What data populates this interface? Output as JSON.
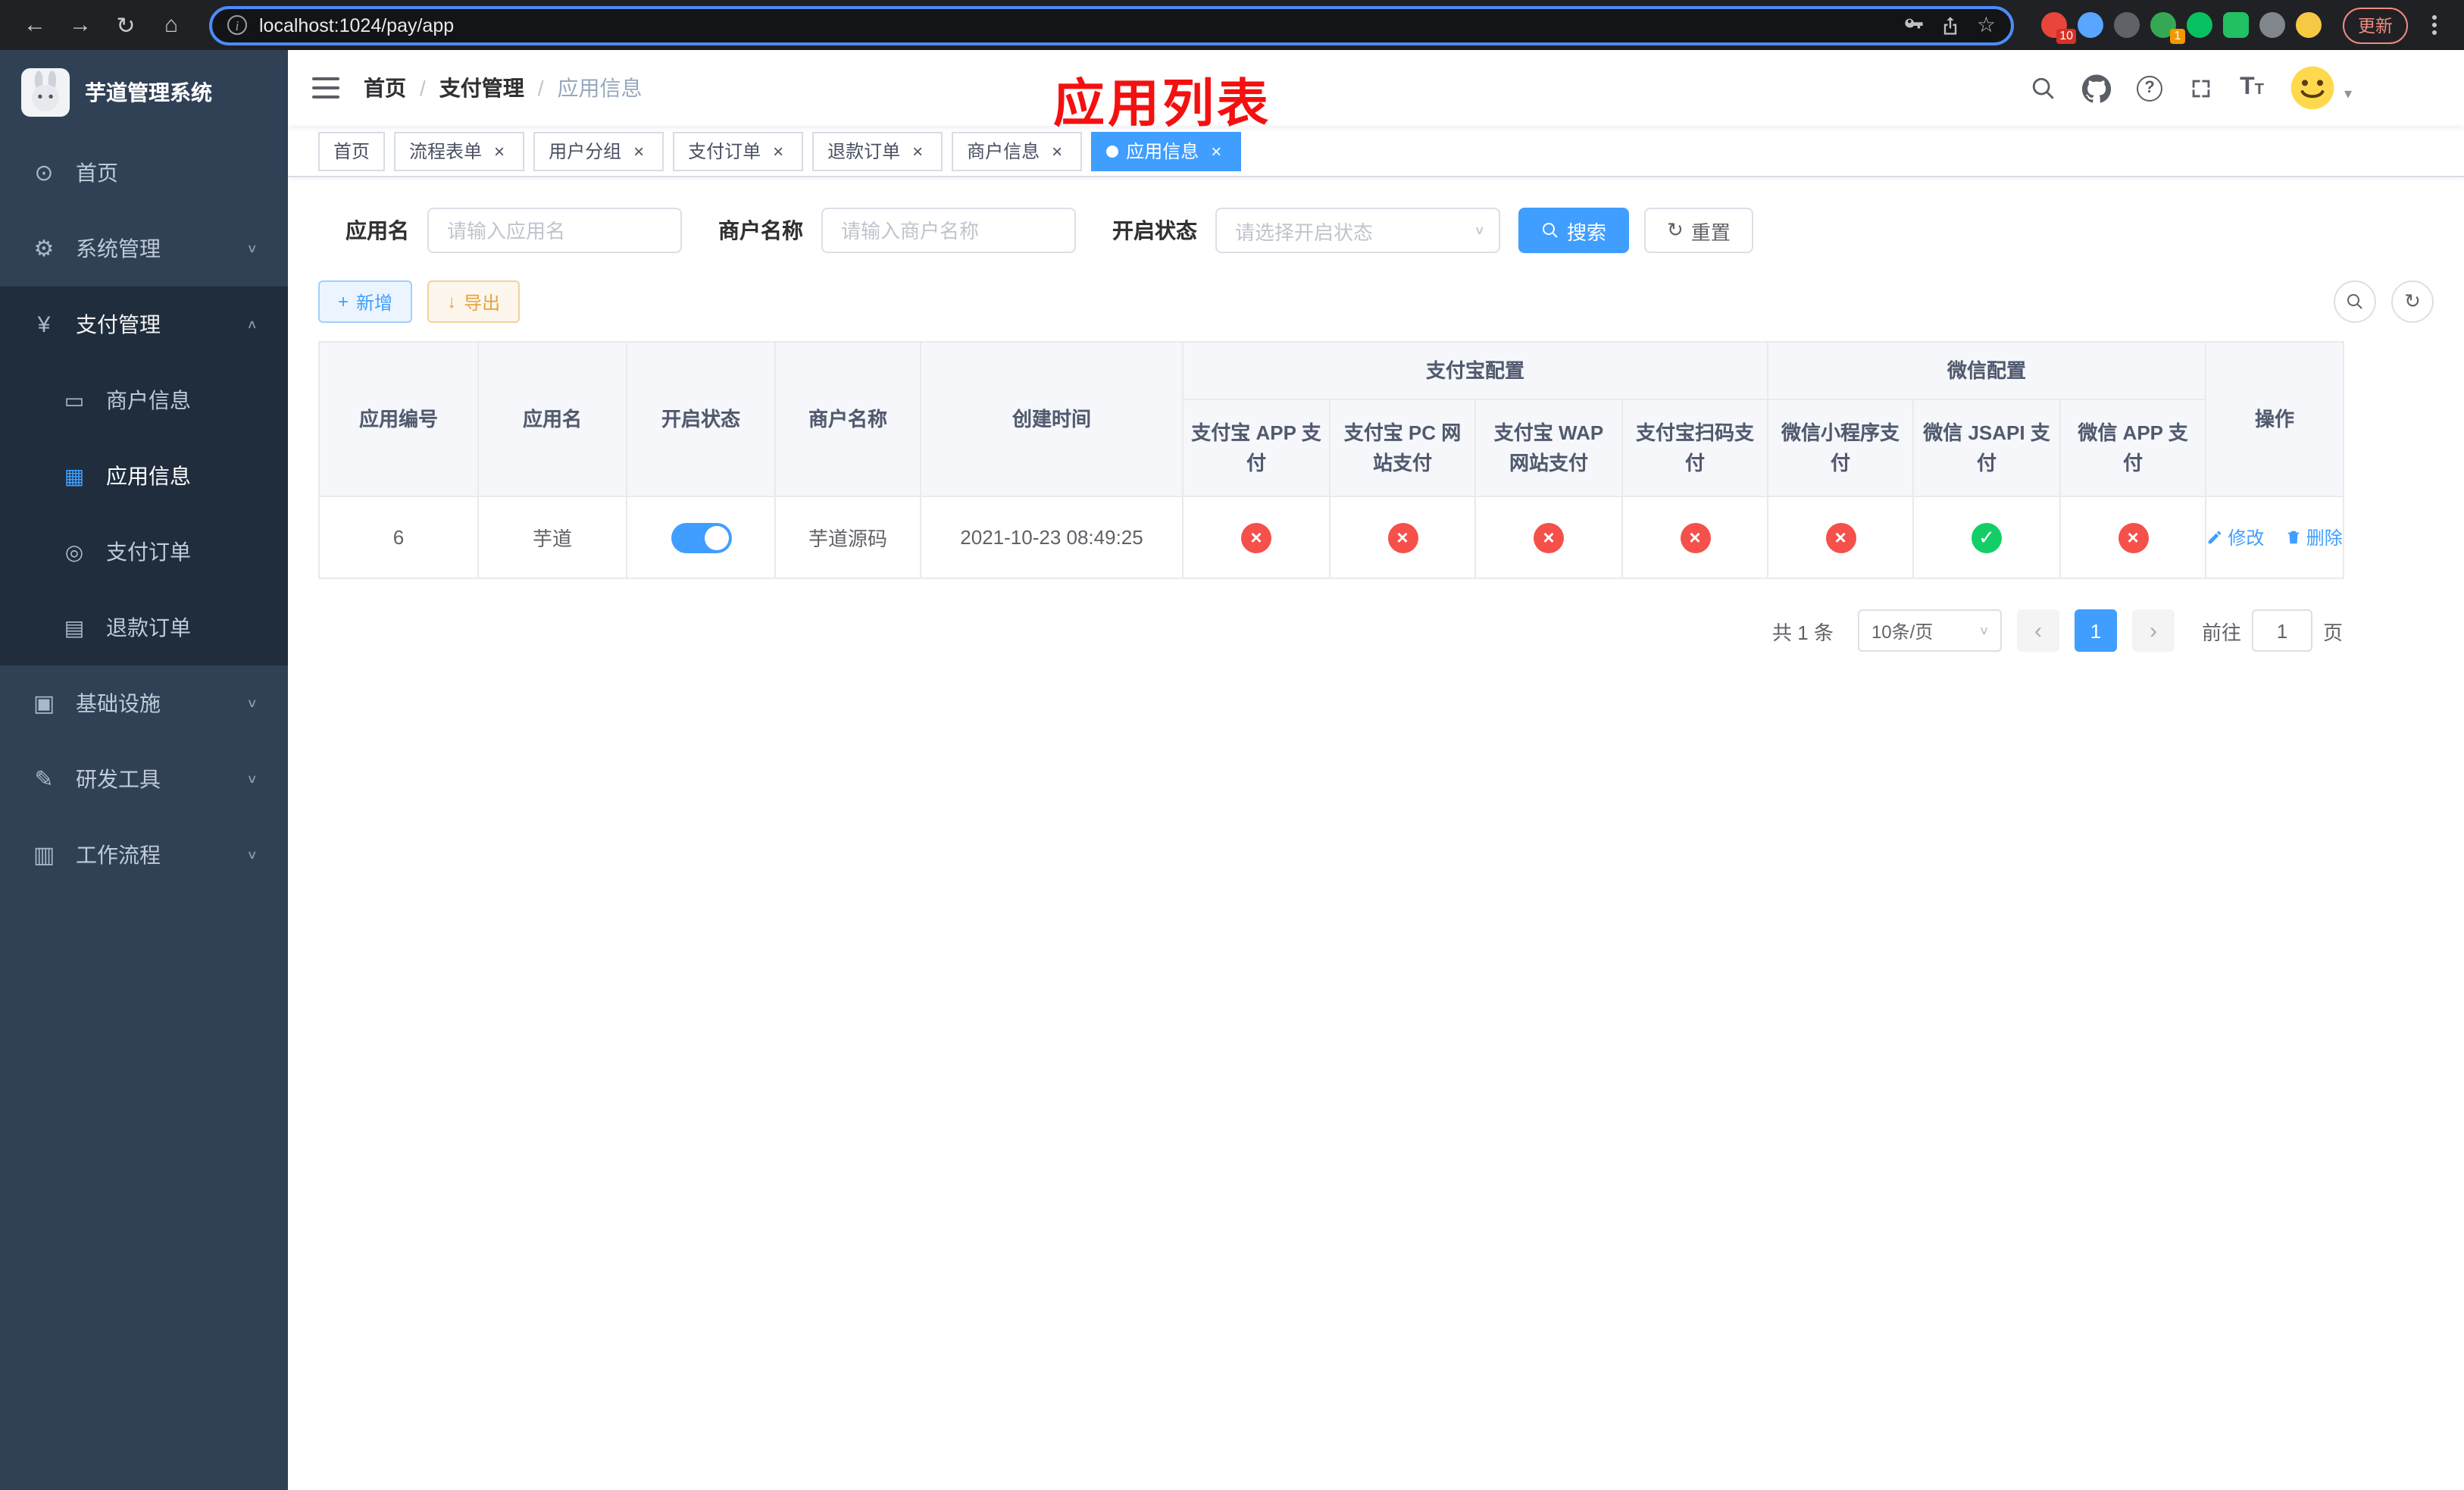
{
  "browser": {
    "url": "localhost:1024/pay/app",
    "update_button": "更新",
    "ext_badges": {
      "first": "10",
      "second": "1"
    }
  },
  "sidebar": {
    "title": "芋道管理系统",
    "menu": [
      {
        "label": "首页"
      },
      {
        "label": "系统管理"
      },
      {
        "label": "支付管理"
      },
      {
        "label": "基础设施"
      },
      {
        "label": "研发工具"
      },
      {
        "label": "工作流程"
      }
    ],
    "pay_submenu": [
      {
        "label": "商户信息"
      },
      {
        "label": "应用信息"
      },
      {
        "label": "支付订单"
      },
      {
        "label": "退款订单"
      }
    ]
  },
  "navbar": {
    "breadcrumb": [
      "首页",
      "支付管理",
      "应用信息"
    ],
    "separator": "/",
    "annotation": "应用列表"
  },
  "tabs": [
    {
      "label": "首页"
    },
    {
      "label": "流程表单"
    },
    {
      "label": "用户分组"
    },
    {
      "label": "支付订单"
    },
    {
      "label": "退款订单"
    },
    {
      "label": "商户信息"
    },
    {
      "label": "应用信息"
    }
  ],
  "filters": {
    "app_name_label": "应用名",
    "app_name_placeholder": "请输入应用名",
    "merchant_label": "商户名称",
    "merchant_placeholder": "请输入商户名称",
    "status_label": "开启状态",
    "status_placeholder": "请选择开启状态",
    "search_button": "搜索",
    "reset_button": "重置"
  },
  "toolbar": {
    "add_button": "新增",
    "export_button": "导出"
  },
  "table": {
    "headers": {
      "app_id": "应用编号",
      "app_name": "应用名",
      "status": "开启状态",
      "merchant": "商户名称",
      "created": "创建时间",
      "alipay_group": "支付宝配置",
      "wechat_group": "微信配置",
      "alipay_cols": [
        "支付宝 APP 支付",
        "支付宝 PC 网站支付",
        "支付宝 WAP 网站支付",
        "支付宝扫码支付"
      ],
      "wechat_cols": [
        "微信小程序支付",
        "微信 JSAPI 支付",
        "微信 APP 支付"
      ],
      "actions": "操作"
    },
    "rows": [
      {
        "app_id": "6",
        "app_name": "芋道",
        "status_on": true,
        "merchant": "芋道源码",
        "created": "2021-10-23 08:49:25",
        "channels": [
          "fail",
          "fail",
          "fail",
          "fail",
          "fail",
          "ok",
          "fail"
        ],
        "edit": "修改",
        "delete": "删除"
      }
    ]
  },
  "pagination": {
    "total": "共 1 条",
    "page_size": "10条/页",
    "current_page": "1",
    "goto_label": "前往",
    "goto_value": "1",
    "page_suffix": "页"
  },
  "colors": {
    "accent": "#409EFF",
    "ok": "#13ce66",
    "fail": "#f5504a",
    "annotation_red": "#f41010"
  }
}
